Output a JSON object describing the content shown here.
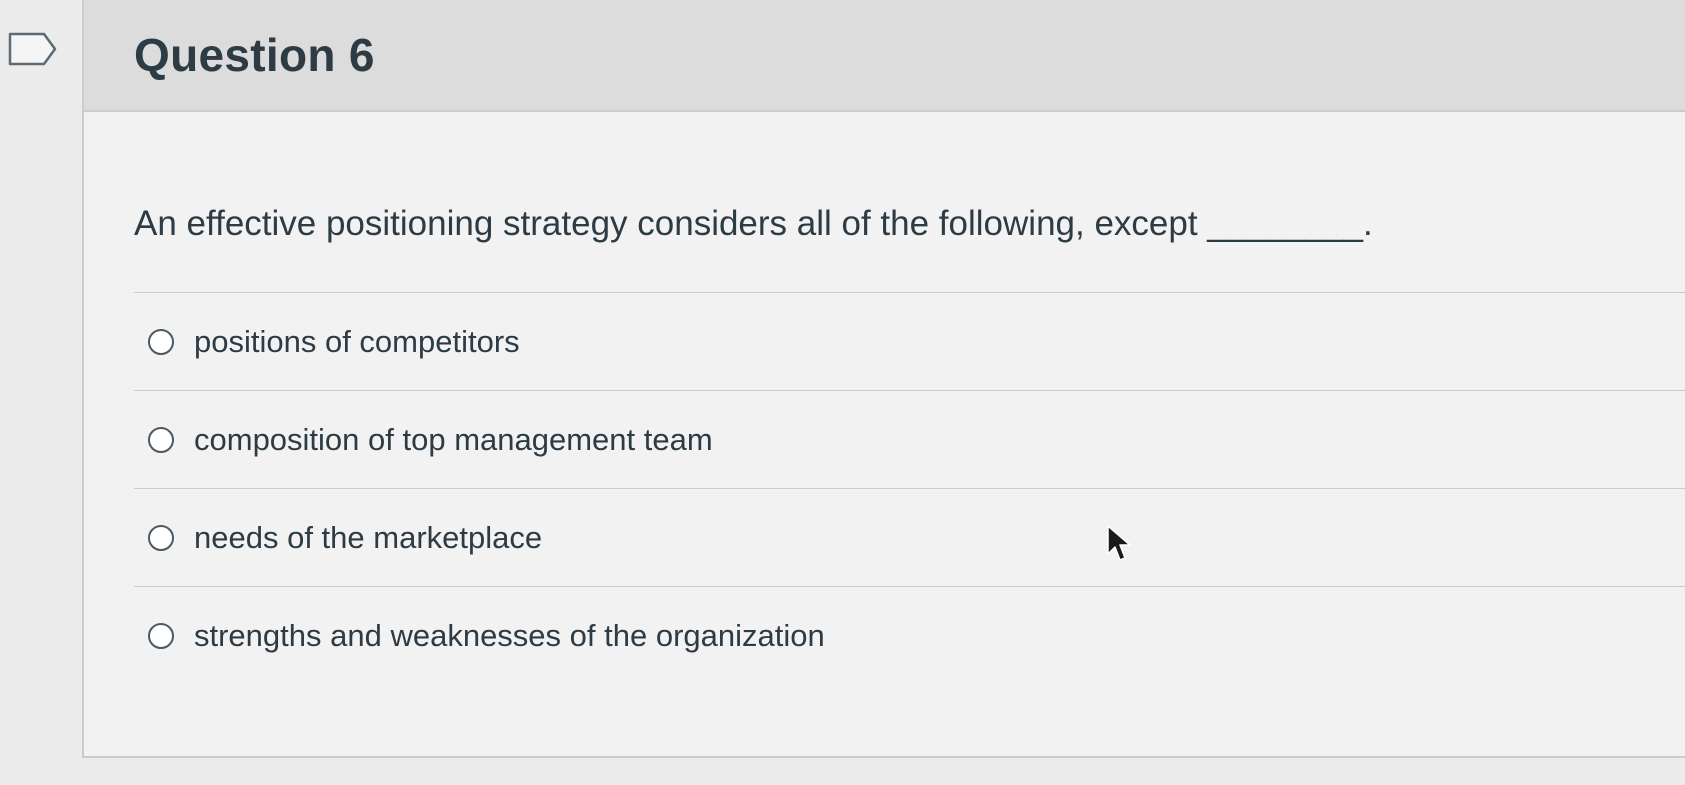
{
  "question": {
    "title": "Question 6",
    "text": "An effective positioning strategy considers all of the following, except ________."
  },
  "answers": [
    {
      "label": "positions of competitors",
      "selected": false
    },
    {
      "label": "composition of top management team",
      "selected": false
    },
    {
      "label": "needs of the marketplace",
      "selected": false
    },
    {
      "label": "strengths and weaknesses of the organization",
      "selected": false
    }
  ],
  "icons": {
    "flag": "flag-question-icon",
    "cursor": "mouse-pointer-icon"
  },
  "colors": {
    "text": "#2d3b45",
    "header_bg": "#dcdcdc",
    "border": "#c7cdd1"
  }
}
